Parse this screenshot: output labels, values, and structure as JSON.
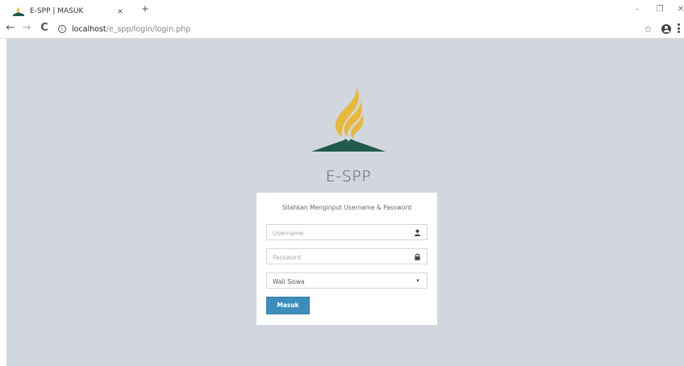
{
  "browser": {
    "tab_title": "E-SPP | MASUK",
    "tab_close": "×",
    "new_tab": "+",
    "url_host": "localhost",
    "url_path": "/e_spp/login/login.php",
    "window_controls": {
      "minimize": "–",
      "restore": "❐",
      "close": "✕"
    },
    "nav": {
      "back": "←",
      "forward": "→",
      "reload": "C"
    }
  },
  "page": {
    "brand": "E-SPP",
    "login_message": "Silahkan Menginput Username & Password",
    "username_placeholder": "Username",
    "password_placeholder": "Password",
    "role_select": {
      "selected": "Wali Siswa",
      "options": [
        "Wali Siswa"
      ]
    },
    "submit_label": "Masuk"
  },
  "colors": {
    "page_background": "#d2d6de",
    "button": "#3c8dbc",
    "logo_gold": "#e8b83a",
    "logo_green": "#1f5a4b"
  },
  "icons": {
    "username": "user-icon",
    "password": "lock-icon",
    "select": "caret-down-icon",
    "favicon": "logo-icon",
    "bookmark": "star-icon",
    "account": "account-icon",
    "menu": "menu-icon"
  }
}
